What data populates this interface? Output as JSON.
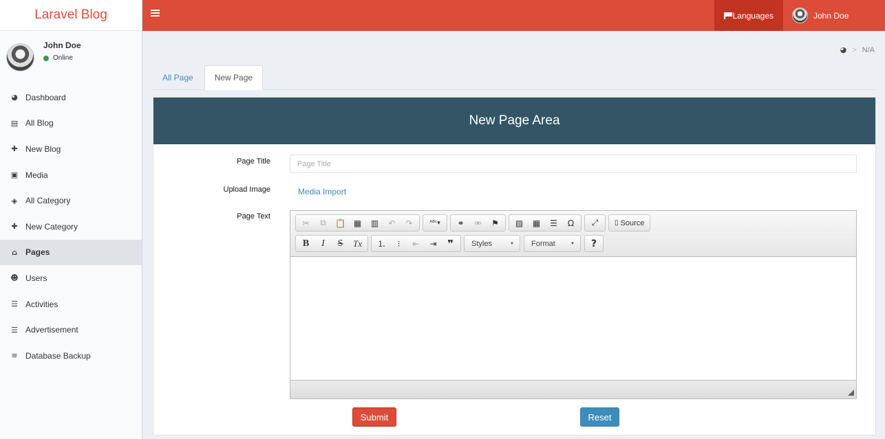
{
  "app": {
    "title": "Laravel Blog"
  },
  "header": {
    "languages_label": "Languages",
    "user_name": "John Doe"
  },
  "user_panel": {
    "name": "John Doe",
    "status": "Online"
  },
  "sidebar": {
    "items": [
      {
        "label": "Dashboard",
        "icon": "dashboard-icon"
      },
      {
        "label": "All Blog",
        "icon": "newspaper-icon"
      },
      {
        "label": "New Blog",
        "icon": "plus-icon"
      },
      {
        "label": "Media",
        "icon": "image-icon"
      },
      {
        "label": "All Category",
        "icon": "tags-icon"
      },
      {
        "label": "New Category",
        "icon": "plus-icon"
      },
      {
        "label": "Pages",
        "icon": "home-icon",
        "active": true
      },
      {
        "label": "Users",
        "icon": "users-icon"
      },
      {
        "label": "Activities",
        "icon": "list-icon"
      },
      {
        "label": "Advertisement",
        "icon": "list-icon"
      },
      {
        "label": "Database Backup",
        "icon": "database-icon"
      }
    ]
  },
  "breadcrumb": {
    "current": "N/A"
  },
  "tabs": [
    {
      "label": "All Page",
      "active": false
    },
    {
      "label": "New Page",
      "active": true
    }
  ],
  "panel": {
    "title": "New Page Area"
  },
  "form": {
    "page_title_label": "Page Title",
    "page_title_placeholder": "Page Title",
    "upload_image_label": "Upload Image",
    "media_import_label": "Media Import",
    "page_text_label": "Page Text"
  },
  "editor": {
    "source_label": "Source",
    "styles_label": "Styles",
    "format_label": "Format"
  },
  "buttons": {
    "submit": "Submit",
    "reset": "Reset"
  },
  "colors": {
    "brand": "#dd4b39",
    "panel_header": "#335566",
    "link": "#3c8dbc"
  }
}
